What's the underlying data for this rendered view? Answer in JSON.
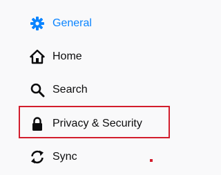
{
  "sidebar": {
    "items": [
      {
        "label": "General",
        "icon": "gear-icon",
        "selected": true
      },
      {
        "label": "Home",
        "icon": "home-icon",
        "selected": false
      },
      {
        "label": "Search",
        "icon": "search-icon",
        "selected": false
      },
      {
        "label": "Privacy & Security",
        "icon": "lock-icon",
        "selected": false,
        "highlighted": true
      },
      {
        "label": "Sync",
        "icon": "sync-icon",
        "selected": false
      }
    ]
  },
  "colors": {
    "accent": "#0a84ff",
    "text": "#0c0c0d",
    "highlight_border": "#d21d2c",
    "background": "#f9f9fa"
  }
}
